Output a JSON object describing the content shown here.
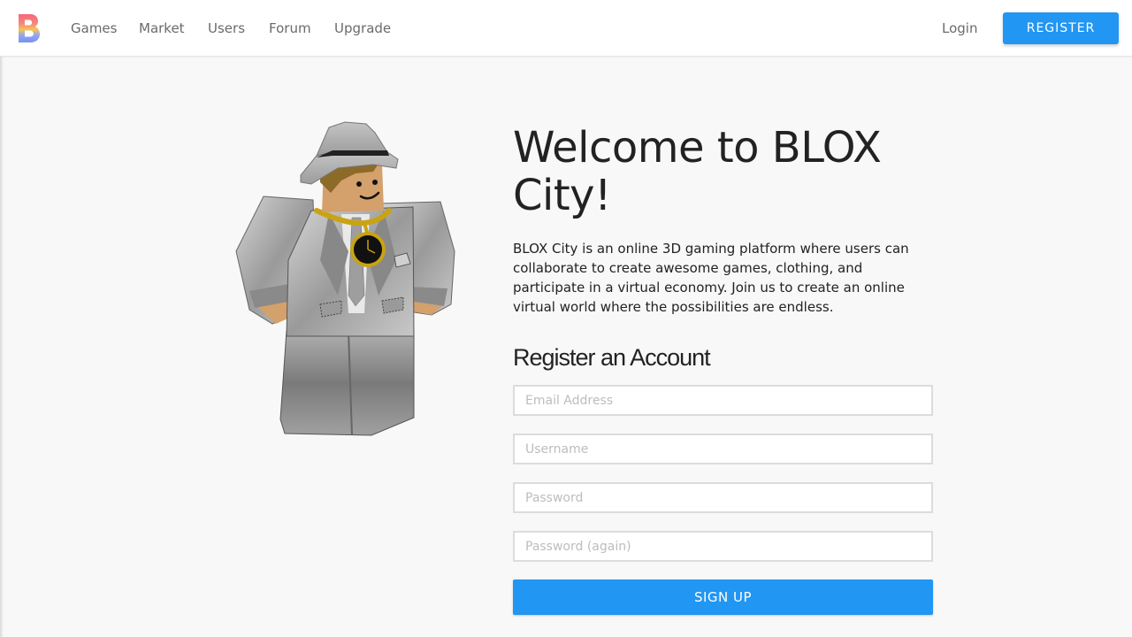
{
  "nav": {
    "logo_icon": "blox-city-logo-icon",
    "links": [
      {
        "label": "Games"
      },
      {
        "label": "Market"
      },
      {
        "label": "Users"
      },
      {
        "label": "Forum"
      },
      {
        "label": "Upgrade"
      }
    ],
    "login_label": "Login",
    "register_label": "REGISTER"
  },
  "hero": {
    "avatar_icon": "avatar-character-image",
    "title": "Welcome to BLOX City!",
    "description": "BLOX City is an online 3D gaming platform where users can collaborate to create awesome games, clothing, and participate in a virtual economy. Join us to create an online virtual world where the possibilities are endless."
  },
  "register_form": {
    "heading": "Register an Account",
    "email_placeholder": "Email Address",
    "username_placeholder": "Username",
    "password_placeholder": "Password",
    "password_again_placeholder": "Password (again)",
    "submit_label": "SIGN UP"
  },
  "colors": {
    "accent": "#2196f3",
    "background": "#f8f8f8",
    "navbar": "#ffffff",
    "nav_text": "#6b6b6b"
  }
}
